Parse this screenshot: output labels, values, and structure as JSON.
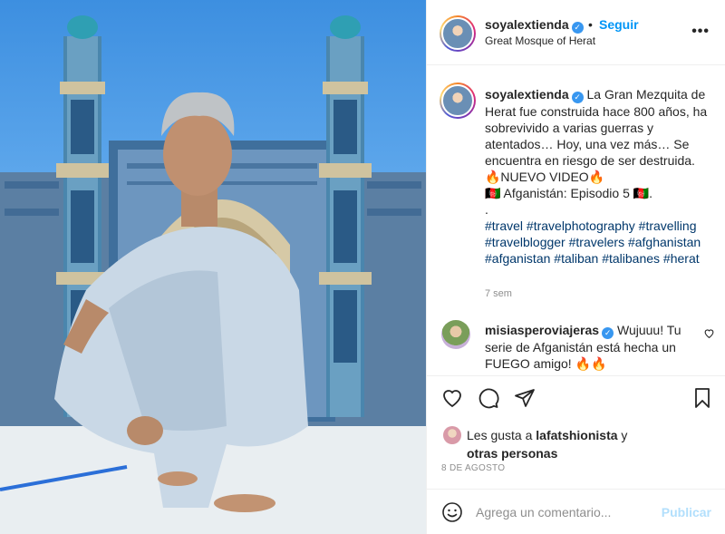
{
  "post": {
    "username": "soyalextienda",
    "follow_label": "Seguir",
    "separator": "•",
    "location": "Great Mosque of Herat",
    "more_label": "•••"
  },
  "caption": {
    "username": "soyalextienda",
    "line1": "La Gran Mezquita de Herat fue construida hace 800 años, ha sobrevivido a varias guerras y atentados… Hoy, una vez más… Se encuentra en riesgo de ser destruida.",
    "line2": "🔥NUEVO VIDEO🔥",
    "line3": "🇦🇫 Afganistán: Episodio 5 🇦🇫.",
    "line4": ".",
    "hashtags": "#travel #travelphotography #travelling #travelblogger #travelers #afghanistan #afganistan #taliban #talibanes #herat",
    "time": "7 sem"
  },
  "comment": {
    "username": "misiasperoviajeras",
    "text": "Wujuuu! Tu serie de Afganistán está hecha un FUEGO amigo! 🔥🔥"
  },
  "likes": {
    "prefix": "Les gusta a",
    "user": "lafatshionista",
    "conjunction": "y",
    "others": "otras personas"
  },
  "date": "8 DE AGOSTO",
  "composer": {
    "placeholder": "Agrega un comentario...",
    "publish_label": "Publicar"
  },
  "colors": {
    "accent": "#0095f6",
    "verified": "#3897f0",
    "hashtag": "#00376b",
    "muted": "#8e8e8e",
    "publish_disabled": "#b2dffc"
  },
  "icons": [
    "verified-badge-icon",
    "more-options-icon",
    "heart-icon",
    "comment-icon",
    "share-icon",
    "save-icon",
    "emoji-icon"
  ]
}
